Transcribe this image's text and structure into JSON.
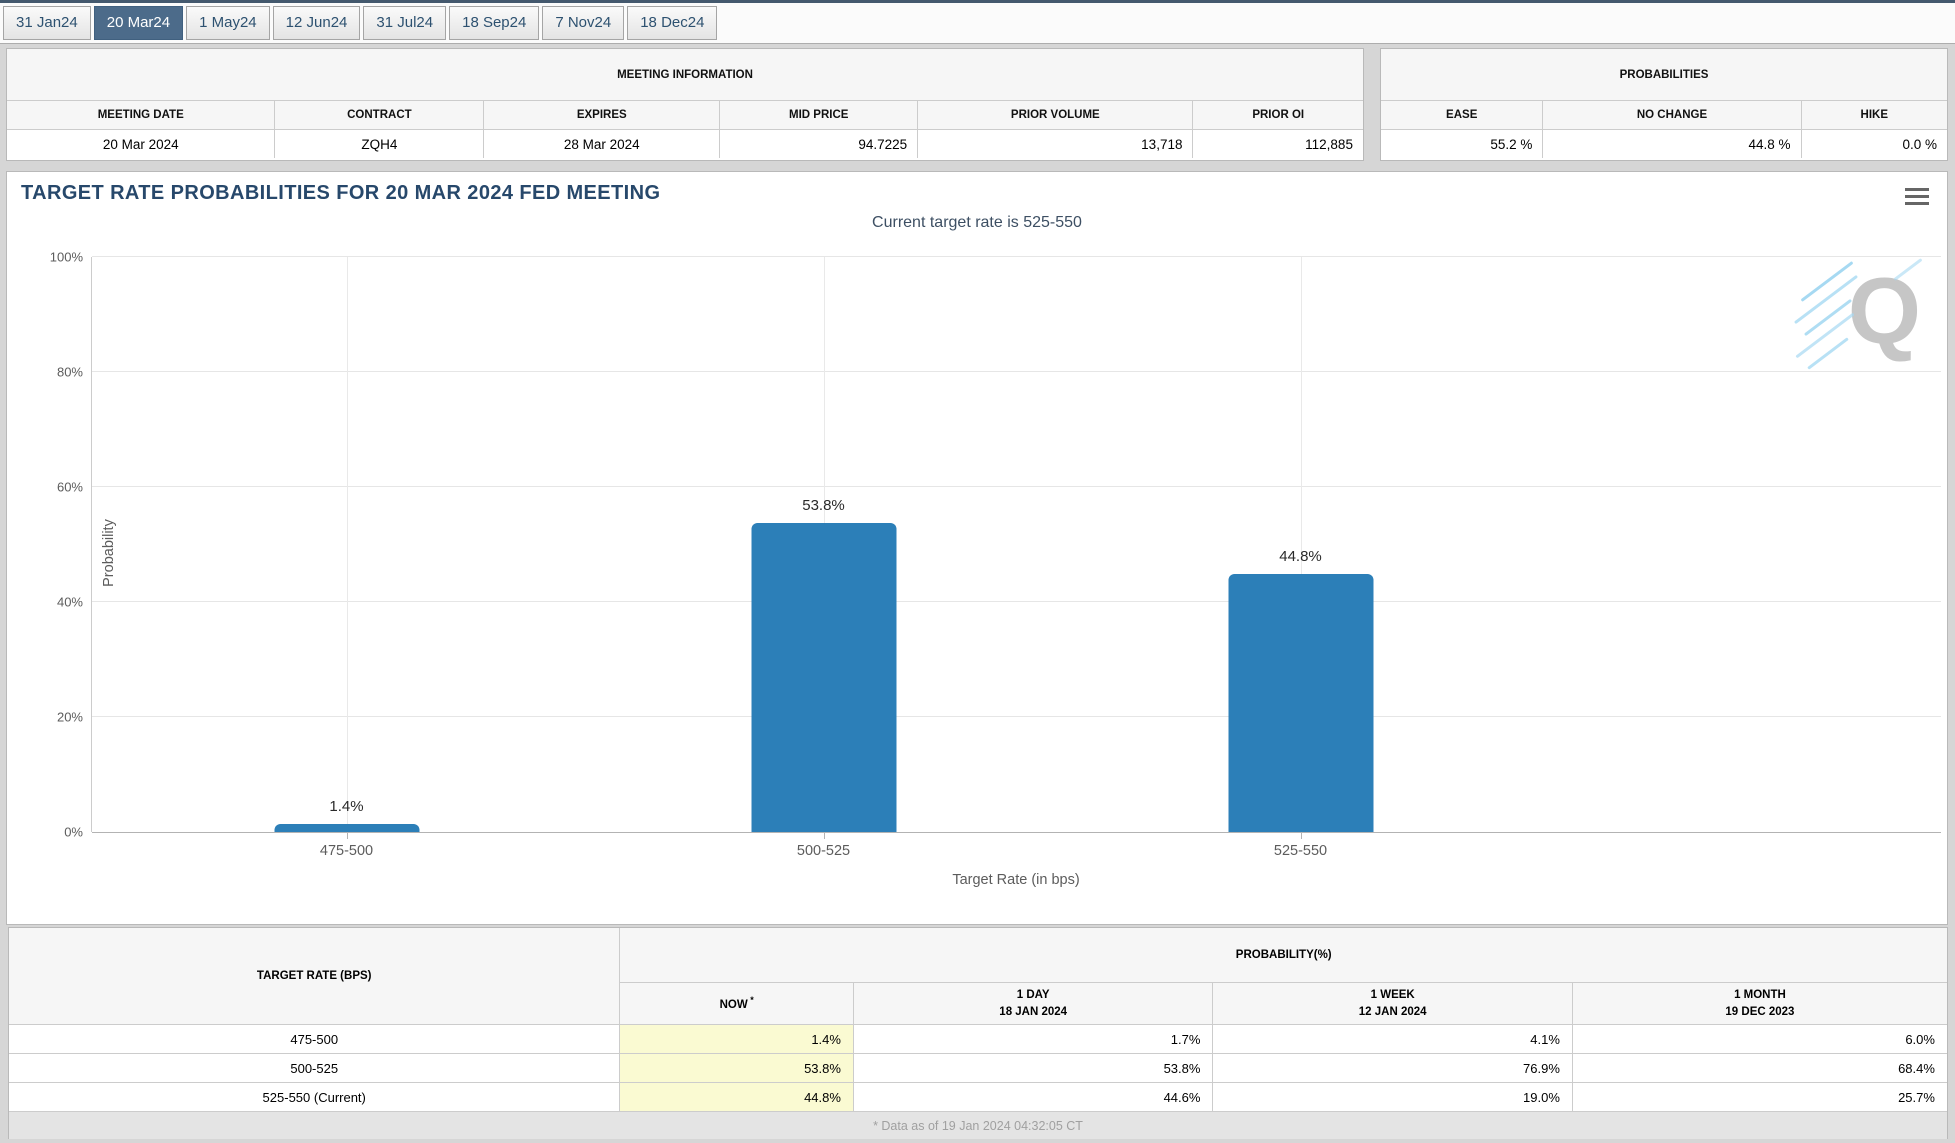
{
  "tabs": {
    "active": "20 Mar24",
    "items": [
      "31 Jan24",
      "20 Mar24",
      "1 May24",
      "12 Jun24",
      "31 Jul24",
      "18 Sep24",
      "7 Nov24",
      "18 Dec24"
    ]
  },
  "meeting_information": {
    "title": "MEETING INFORMATION",
    "columns": [
      "MEETING DATE",
      "CONTRACT",
      "EXPIRES",
      "MID PRICE",
      "PRIOR VOLUME",
      "PRIOR OI"
    ],
    "values": [
      "20 Mar 2024",
      "ZQH4",
      "28 Mar 2024",
      "94.7225",
      "13,718",
      "112,885"
    ]
  },
  "probabilities_summary": {
    "title": "PROBABILITIES",
    "columns": [
      "EASE",
      "NO CHANGE",
      "HIKE"
    ],
    "values": [
      "55.2 %",
      "44.8 %",
      "0.0 %"
    ]
  },
  "chart": {
    "title": "TARGET RATE PROBABILITIES FOR 20 MAR 2024 FED MEETING",
    "subtitle": "Current target rate is 525-550",
    "watermark_letter": "Q",
    "bar_color": "#2c7fb8",
    "title_color": "#27486b"
  },
  "chart_data": {
    "type": "bar",
    "title": "TARGET RATE PROBABILITIES FOR 20 MAR 2024 FED MEETING",
    "subtitle": "Current target rate is 525-550",
    "categories": [
      "475-500",
      "500-525",
      "525-550"
    ],
    "values": [
      1.4,
      53.8,
      44.8
    ],
    "labels": [
      "1.4%",
      "53.8%",
      "44.8%"
    ],
    "xlabel": "Target Rate (in bps)",
    "ylabel": "Probability",
    "ylim": [
      0,
      100
    ],
    "yticks": [
      "0%",
      "20%",
      "40%",
      "60%",
      "80%",
      "100%"
    ],
    "grid": true,
    "legend_position": "none"
  },
  "history_table": {
    "row_header": "TARGET RATE (BPS)",
    "group_header": "PROBABILITY(%)",
    "columns": [
      {
        "line1": "NOW",
        "sup": "*",
        "line2": ""
      },
      {
        "line1": "1 DAY",
        "sup": "",
        "line2": "18 JAN 2024"
      },
      {
        "line1": "1 WEEK",
        "sup": "",
        "line2": "12 JAN 2024"
      },
      {
        "line1": "1 MONTH",
        "sup": "",
        "line2": "19 DEC 2023"
      }
    ],
    "rows": [
      {
        "label": "475-500",
        "values": [
          "1.4%",
          "1.7%",
          "4.1%",
          "6.0%"
        ]
      },
      {
        "label": "500-525",
        "values": [
          "53.8%",
          "53.8%",
          "76.9%",
          "68.4%"
        ]
      },
      {
        "label": "525-550 (Current)",
        "values": [
          "44.8%",
          "44.6%",
          "19.0%",
          "25.7%"
        ]
      }
    ],
    "footnote": "* Data as of 19 Jan 2024 04:32:05 CT",
    "highlight_color": "#fafad2"
  }
}
